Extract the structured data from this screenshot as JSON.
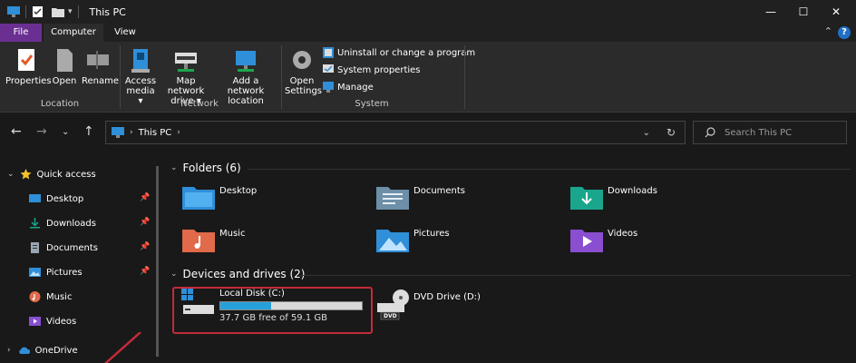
{
  "window": {
    "title": "This PC",
    "controls": {
      "minimize": "—",
      "maximize": "☐",
      "close": "✕"
    }
  },
  "tabs": {
    "file": "File",
    "computer": "Computer",
    "view": "View",
    "help": "?"
  },
  "ribbon": {
    "location": {
      "label": "Location",
      "properties": "Properties",
      "open": "Open",
      "rename": "Rename"
    },
    "network": {
      "label": "Network",
      "access_media_line1": "Access",
      "access_media_line2": "media ▾",
      "map_drive_line1": "Map network",
      "map_drive_line2": "drive ▾",
      "add_location_line1": "Add a network",
      "add_location_line2": "location"
    },
    "system": {
      "label": "System",
      "open_settings_line1": "Open",
      "open_settings_line2": "Settings",
      "uninstall": "Uninstall or change a program",
      "system_properties": "System properties",
      "manage": "Manage"
    }
  },
  "address": {
    "path": "This PC",
    "search_placeholder": "Search This PC"
  },
  "sidebar": {
    "items": [
      {
        "label": "Quick access",
        "icon": "star-icon"
      },
      {
        "label": "Desktop",
        "icon": "desktop-icon"
      },
      {
        "label": "Downloads",
        "icon": "download-icon"
      },
      {
        "label": "Documents",
        "icon": "document-icon"
      },
      {
        "label": "Pictures",
        "icon": "picture-icon"
      },
      {
        "label": "Music",
        "icon": "music-icon"
      },
      {
        "label": "Videos",
        "icon": "video-icon"
      },
      {
        "label": "OneDrive",
        "icon": "cloud-icon"
      }
    ]
  },
  "folders": {
    "header": "Folders (6)",
    "items": [
      {
        "name": "Desktop",
        "icon": "desktop-folder-icon",
        "color": "#2f8fd8"
      },
      {
        "name": "Documents",
        "icon": "documents-folder-icon",
        "color": "#6d8fa8"
      },
      {
        "name": "Downloads",
        "icon": "downloads-folder-icon",
        "color": "#1aa68c"
      },
      {
        "name": "Music",
        "icon": "music-folder-icon",
        "color": "#e06a4a"
      },
      {
        "name": "Pictures",
        "icon": "pictures-folder-icon",
        "color": "#2f8fd8"
      },
      {
        "name": "Videos",
        "icon": "videos-folder-icon",
        "color": "#8a4fd0"
      }
    ]
  },
  "drives": {
    "header": "Devices and drives (2)",
    "items": [
      {
        "name": "Local Disk (C:)",
        "free_text": "37.7 GB free of 59.1 GB",
        "used_fraction": 0.36,
        "icon": "hard-drive-icon"
      },
      {
        "name": "DVD Drive (D:)",
        "icon": "dvd-drive-icon",
        "badge": "DVD"
      }
    ]
  },
  "colors": {
    "accent": "#26a0da",
    "file_tab": "#6b2f92",
    "highlight": "#c42b3a"
  }
}
